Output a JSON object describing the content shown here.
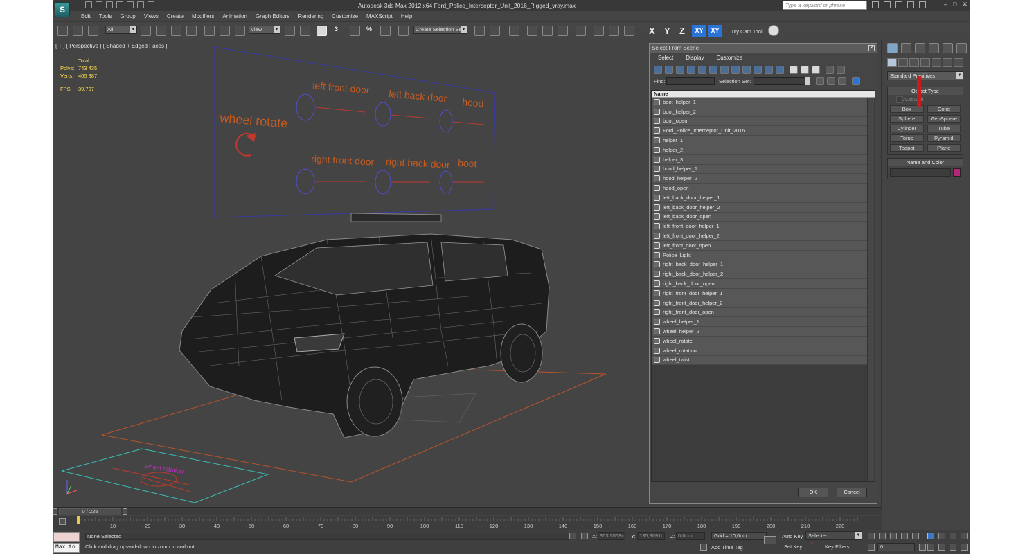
{
  "window": {
    "title": "Autodesk 3ds Max  2012 x64    Ford_Police_Interceptor_Unit_2016_Rigged_vray.max",
    "search_placeholder": "Type a keyword or phrase",
    "app_logo": "S"
  },
  "menu": [
    "Edit",
    "Tools",
    "Group",
    "Views",
    "Create",
    "Modifiers",
    "Animation",
    "Graph Editors",
    "Rendering",
    "Customize",
    "MAXScript",
    "Help"
  ],
  "toolbar": {
    "selection_filter": "All",
    "ref_coord": "View",
    "snap_label": "3",
    "angle_label": "%",
    "named_sel_placeholder": "Create Selection Se",
    "axis_x": "X",
    "axis_y": "Y",
    "axis_z": "Z",
    "axis_xy": "XY",
    "axis_xy2": "XY",
    "cam_tool": "uty Cam Tool"
  },
  "viewport": {
    "label": "[ + ] [ Perspective ] [ Shaded + Edged Faces ]",
    "stats": {
      "total": "Total",
      "polys_label": "Polys:",
      "polys": "743 435",
      "verts_label": "Verts:",
      "verts": "405 387",
      "fps_label": "FPS:",
      "fps": "39,737"
    },
    "helper_panel": {
      "wheel_rotate": "wheel rotate",
      "left_front_door": "left front door",
      "left_back_door": "left back door",
      "hood": "hood",
      "right_front_door": "right front door",
      "right_back_door": "right back door",
      "boot": "boot"
    },
    "ground_label": "wheel rotation"
  },
  "dialog": {
    "title": "Select From Scene",
    "menu": [
      "Select",
      "Display",
      "Customize"
    ],
    "find_label": "Find:",
    "selset_label": "Selection Set:",
    "column_name": "Name",
    "objects": [
      "boot_helper_1",
      "boot_helper_2",
      "boot_open",
      "Ford_Police_Interceptor_Unit_2016",
      "helper_1",
      "helper_2",
      "helper_3",
      "hood_helper_1",
      "hood_helper_2",
      "hood_open",
      "left_back_door_helper_1",
      "left_back_door_helper_2",
      "left_back_door_open",
      "left_front_door_helper_1",
      "left_front_door_helper_2",
      "left_front_door_open",
      "Police_Light",
      "right_back_door_helper_1",
      "right_back_door_helper_2",
      "right_back_door_open",
      "right_front_door_helper_1",
      "right_front_door_helper_2",
      "right_front_door_open",
      "wheel_helper_1",
      "wheel_helper_2",
      "wheel_rotate",
      "wheel_rotation",
      "wheel_twist"
    ],
    "ok": "OK",
    "cancel": "Cancel"
  },
  "command_panel": {
    "primitive_type": "Standard Primitives",
    "object_type_title": "Object Type",
    "autogrid": "AutoGrid",
    "primitives": [
      "Box",
      "Cone",
      "Sphere",
      "GeoSphere",
      "Cylinder",
      "Tube",
      "Torus",
      "Pyramid",
      "Teapot",
      "Plane"
    ],
    "name_color_title": "Name and Color",
    "object_color": "#b8267a"
  },
  "timeline": {
    "frame_display": "0 / 225",
    "ticks": [
      "10",
      "20",
      "30",
      "40",
      "50",
      "60",
      "70",
      "80",
      "90",
      "100",
      "110",
      "120",
      "130",
      "140",
      "150",
      "160",
      "170",
      "180",
      "190",
      "200",
      "210",
      "220"
    ]
  },
  "status": {
    "maxscript": "Max to",
    "selection": "None Selected",
    "prompt": "Click and drag up-and-down to zoom in and out",
    "x_label": "X:",
    "x": "353,5558c",
    "y_label": "Y:",
    "y": "135,9091c",
    "z_label": "Z:",
    "z": "0,0cm",
    "grid": "Grid = 10,0cm",
    "add_time_tag": "Add Time Tag",
    "auto_key": "Auto Key",
    "set_key": "Set Key",
    "key_mode": "Selected",
    "key_filters": "Key Filters...",
    "frame": "0"
  }
}
